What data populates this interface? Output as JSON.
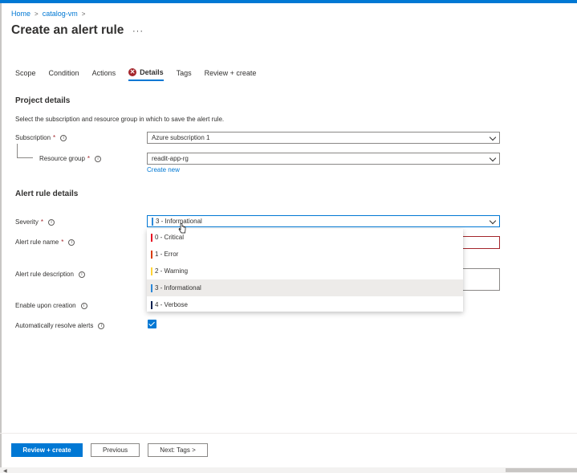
{
  "breadcrumb": {
    "home": "Home",
    "vm": "catalog-vm",
    "sep": ">"
  },
  "page": {
    "title": "Create an alert rule",
    "more": "···"
  },
  "tabs": [
    {
      "label": "Scope"
    },
    {
      "label": "Condition"
    },
    {
      "label": "Actions"
    },
    {
      "label": "Details",
      "icon": "error-icon",
      "active": true
    },
    {
      "label": "Tags"
    },
    {
      "label": "Review + create"
    }
  ],
  "project": {
    "title": "Project details",
    "description": "Select the subscription and resource group in which to save the alert rule.",
    "subscription_label": "Subscription",
    "subscription_value": "Azure subscription 1",
    "resource_group_label": "Resource group",
    "resource_group_value": "readit-app-rg",
    "create_new": "Create new"
  },
  "alert": {
    "title": "Alert rule details",
    "severity_label": "Severity",
    "severity_value": "3 - Informational",
    "name_label": "Alert rule name",
    "description_label": "Alert rule description",
    "enable_label": "Enable upon creation",
    "auto_resolve_label": "Automatically resolve alerts"
  },
  "severity_options": [
    {
      "label": "0 - Critical",
      "color": "#e81123"
    },
    {
      "label": "1 - Error",
      "color": "#d83b01"
    },
    {
      "label": "2 - Warning",
      "color": "#ffd335"
    },
    {
      "label": "3 - Informational",
      "color": "#2b88d8",
      "selected": true
    },
    {
      "label": "4 - Verbose",
      "color": "#002050"
    }
  ],
  "required_mark": "*",
  "info_mark": "i",
  "footer": {
    "review_create": "Review + create",
    "previous": "Previous",
    "next": "Next: Tags >"
  },
  "colors": {
    "accent": "#0078d4",
    "error": "#a4262c"
  }
}
